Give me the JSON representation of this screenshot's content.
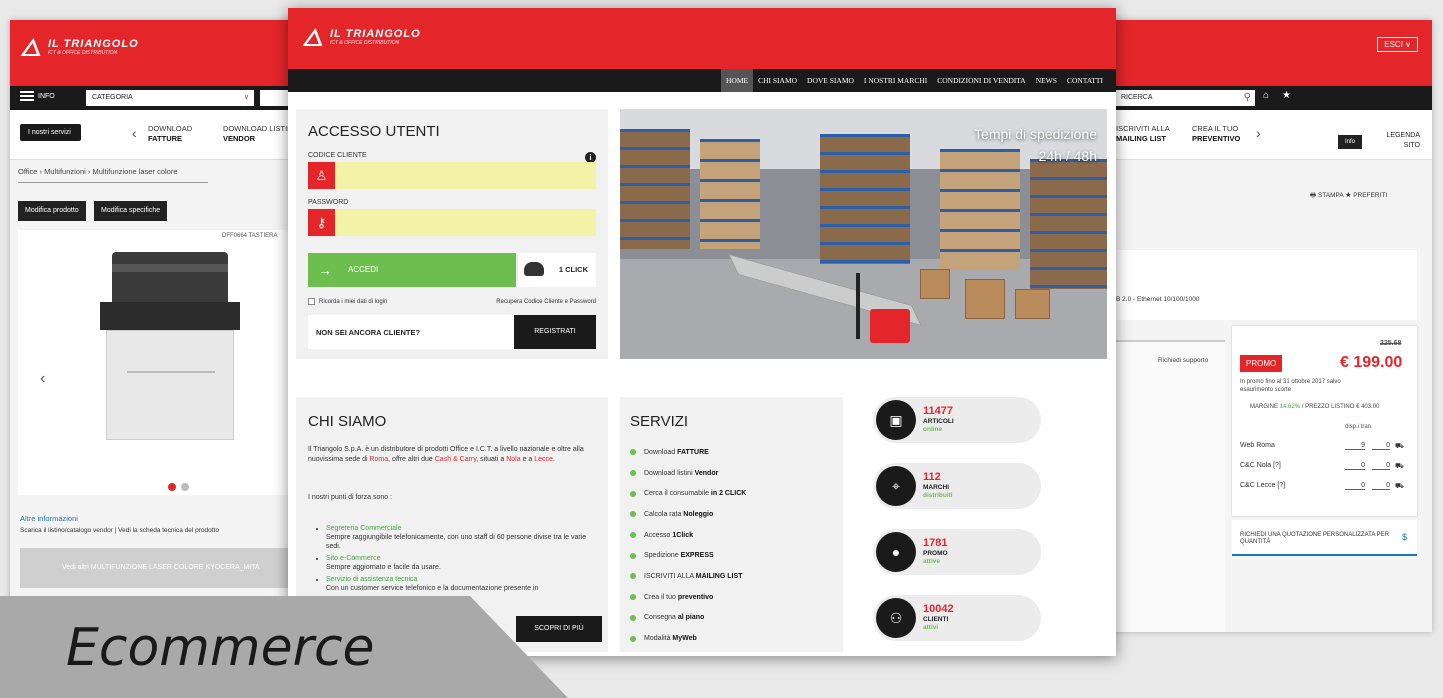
{
  "colors": {
    "brand_red": "#e4262b",
    "accent_green": "#6cbf4f",
    "dark": "#1a1a1a"
  },
  "logo": {
    "name": "IL TRIANGOLO",
    "tagline": "ICT & OFFICE DISTRIBUTION"
  },
  "back": {
    "lang": "ESCI ∨",
    "menu_label": "INFO",
    "category_select": "CATEGORIA",
    "search_value": "RICERCA",
    "services_chip": "I nostri servizi",
    "services": [
      {
        "l1": "DOWNLOAD",
        "l2": "FATTURE"
      },
      {
        "l1": "DOWNLOAD LISTINI",
        "l2": "VENDOR"
      }
    ],
    "services_right": [
      {
        "l1": "ISCRIVITI ALLA",
        "l2": "MAILING LIST"
      },
      {
        "l1": "CREA IL TUO",
        "l2": "PREVENTIVO"
      }
    ],
    "info_chip": "Info",
    "legend": {
      "l1": "LEGENDA",
      "l2": "SITO"
    },
    "breadcrumb": "Office › Multifunzioni › Multifunzione laser colore",
    "edit_product": "Modifica prodotto",
    "edit_specs": "Modifica specifiche",
    "sku": "DFF0664 TASTIERA",
    "print_links": "🖶 STAMPA  ★ PREFERITI",
    "more_info_title": "Altre informazioni",
    "more_info_text": "Scarica il listino/catalogo vendor  |  Vedi la scheda tecnica del prodotto",
    "see_all": "Vedi altri MULTIFUNZIONE LASER COLORE KYOCERA_MITA",
    "spec_text": "USB 2.0 - Ethernet 10/100/1000",
    "support_label": "Richiedi supporto",
    "old_price": "225.68",
    "promo": "PROMO",
    "price": "€ 199.00",
    "promo_note": "In promo fino al 31 ottobre 2017 salvo esaurimento scorte",
    "margin": "MARGINE",
    "margin_pct": "14.62%",
    "list_price": "PREZZO LISTINO € 403.00",
    "stock_head": "disp.i   tran.",
    "stock": [
      {
        "name": "Web Roma",
        "qty": "9",
        "transit": "0"
      },
      {
        "name": "C&C Nola [?]",
        "qty": "0",
        "transit": "0"
      },
      {
        "name": "C&C Lecce [?]",
        "qty": "0",
        "transit": "0"
      }
    ],
    "quote": "RICHIEDI UNA QUOTAZIONE PERSONALIZZATA PER QUANTITÀ"
  },
  "front": {
    "nav": [
      "HOME",
      "CHI SIAMO",
      "DOVE SIAMO",
      "I NOSTRI MARCHI",
      "CONDIZIONI DI VENDITA",
      "NEWS",
      "CONTATTI"
    ],
    "login": {
      "title": "ACCESSO UTENTI",
      "code_label": "CODICE CLIENTE",
      "password_label": "PASSWORD",
      "login_button": "ACCEDI",
      "oneclick": "1 CLICK",
      "remember": "Ricorda i miei dati di login",
      "recover": "Recupera Codice Cliente e Password",
      "not_customer": "NON SEI ANCORA CLIENTE?",
      "register": "REGISTRATI"
    },
    "hero": {
      "line1": "Tempi di spedizione",
      "line2": "24h / 48h"
    },
    "about": {
      "title": "CHI SIAMO",
      "p1a": "Il Triangolo S.p.A. è un distributore di prodotti Office e I.C.T. a livello nazionale e oltre alla nuovissima sede di ",
      "p1_roma": "Roma",
      "p1b": ", offre altri due ",
      "p1_cc": "Cash & Carry",
      "p1c": ", situati a ",
      "p1_nola": "Nola",
      "p1d": " e a ",
      "p1_lecce": "Lecce",
      "p1e": ".",
      "p2": "I nostri punti di forza sono :",
      "points": [
        {
          "title": "Segreteria Commerciale",
          "text": "Sempre raggiungibile telefonicamente, con uno staff di 60 persone divise tra le varie sedi."
        },
        {
          "title": "Sito e-Commerce",
          "text": "Sempre aggiornato e facile da usare."
        },
        {
          "title": "Servizio di assistenza tecnica",
          "text": "Con un customer service telefonico e la documentazione presente in"
        }
      ],
      "more": "SCOPRI DI PIÙ"
    },
    "services": {
      "title": "SERVIZI",
      "items": [
        {
          "pre": "Download ",
          "bold": "FATTURE"
        },
        {
          "pre": "Download listini ",
          "bold": "Vendor"
        },
        {
          "pre": "Cerca il consumabile ",
          "bold": "in 2 CLICK"
        },
        {
          "pre": "Calcola rata ",
          "bold": "Noleggio"
        },
        {
          "pre": "Accesso ",
          "bold": "1Click"
        },
        {
          "pre": "Spedizione ",
          "bold": "EXPRESS"
        },
        {
          "pre": "ISCRIVITI ALLA ",
          "bold": "MAILING LIST"
        },
        {
          "pre": "Crea il tuo ",
          "bold": "preventivo"
        },
        {
          "pre": "Consegna ",
          "bold": "al piano"
        },
        {
          "pre": "Modalità ",
          "bold": "MyWeb"
        }
      ]
    },
    "stats": [
      {
        "num": "11477",
        "l1": "ARTICOLI",
        "l2": "online",
        "icon": "box-icon"
      },
      {
        "num": "112",
        "l1": "MARCHI",
        "l2": "distribuiti",
        "icon": "tag-icon"
      },
      {
        "num": "1781",
        "l1": "PROMO",
        "l2": "attive",
        "icon": "promo-icon"
      },
      {
        "num": "10042",
        "l1": "CLIENTI",
        "l2": "attivi",
        "icon": "users-icon"
      }
    ]
  },
  "banner": {
    "label": "Ecommerce"
  }
}
